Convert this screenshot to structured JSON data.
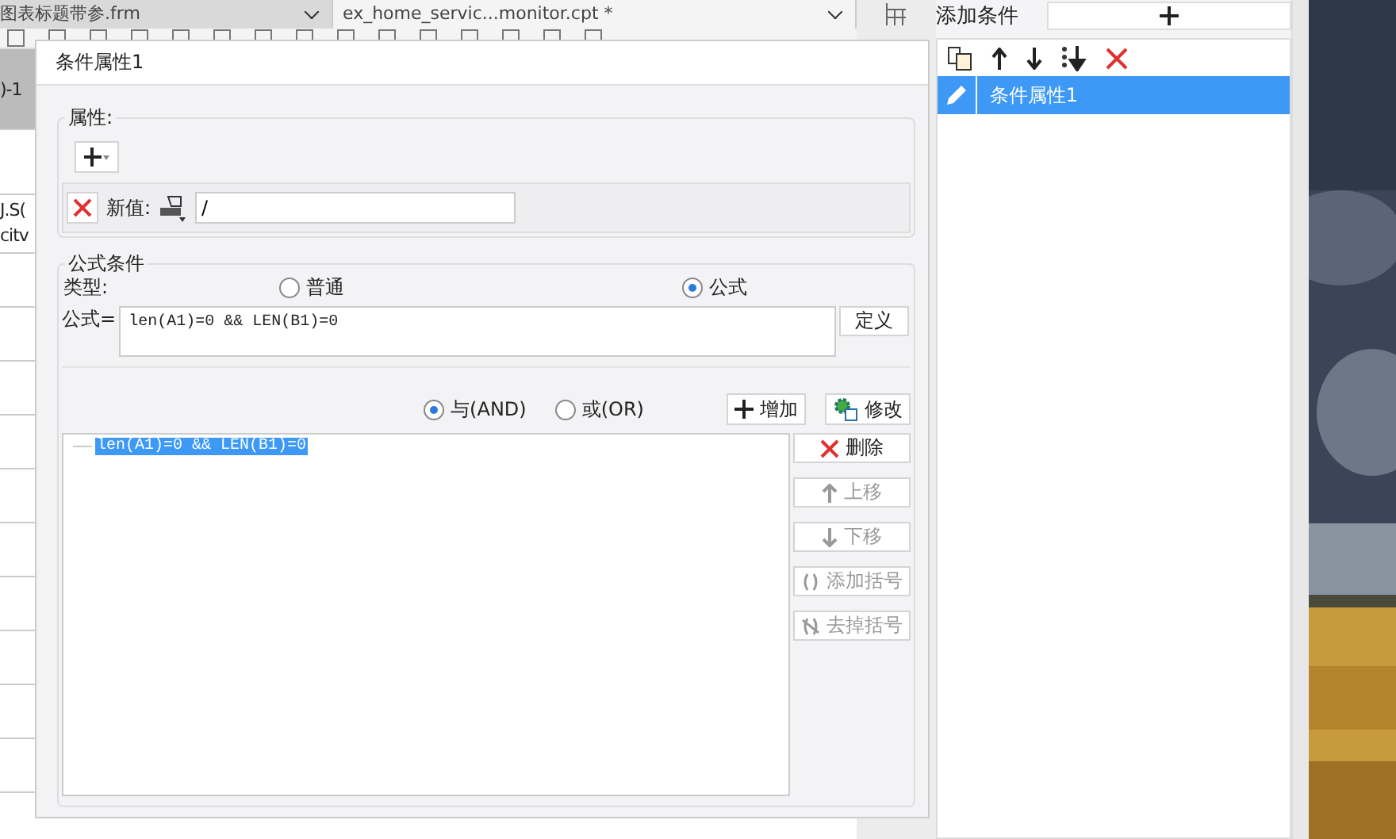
{
  "background_tabs": [
    {
      "label": "图表标题带参.frm",
      "selected": false
    },
    {
      "label": "ex_home_servic...monitor.cpt *",
      "selected": true
    }
  ],
  "sheet_cells": [
    ")-1",
    "J.S(",
    "citv"
  ],
  "conditions_panel": {
    "title": "添加条件",
    "items": [
      {
        "label": "条件属性1",
        "selected": true
      }
    ]
  },
  "dialog": {
    "title": "条件属性1",
    "attributes": {
      "legend": "属性:",
      "new_value_label": "新值:",
      "new_value": "/"
    },
    "formula_condition": {
      "legend": "公式条件",
      "type_label": "类型:",
      "types": [
        {
          "label": "普通",
          "selected": false
        },
        {
          "label": "公式",
          "selected": true
        }
      ],
      "formula_label": "公式=",
      "formula": "len(A1)=0 && LEN(B1)=0",
      "define_button": "定义",
      "logic": [
        {
          "label": "与(AND)",
          "selected": true
        },
        {
          "label": "或(OR)",
          "selected": false
        }
      ],
      "add_button": "增加",
      "modify_button": "修改",
      "conditions": [
        {
          "text": "len(A1)=0 && LEN(B1)=0",
          "selected": true
        }
      ],
      "side_buttons": [
        {
          "kind": "delete",
          "label": "删除",
          "disabled": false
        },
        {
          "kind": "up",
          "label": "上移",
          "disabled": true
        },
        {
          "kind": "down",
          "label": "下移",
          "disabled": true
        },
        {
          "kind": "add-brackets",
          "label": "添加括号",
          "disabled": true
        },
        {
          "kind": "remove-brackets",
          "label": "去掉括号",
          "disabled": true
        }
      ]
    }
  }
}
